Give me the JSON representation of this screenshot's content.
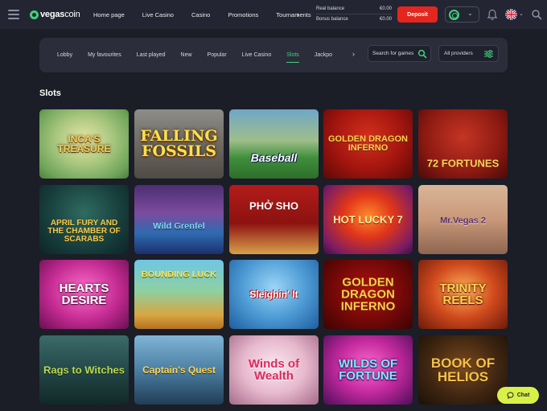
{
  "brand": {
    "name_bold": "vegas",
    "name_light": "coin"
  },
  "topnav": {
    "items": [
      "Home page",
      "Live Casino",
      "Casino",
      "Promotions",
      "Tournaments"
    ],
    "more_arrow": "›"
  },
  "balances": {
    "real_label": "Real balance",
    "real_value": "€0.00",
    "bonus_label": "Bonus balance",
    "bonus_value": "€0.00"
  },
  "header": {
    "deposit_label": "Deposit",
    "chevron": "⌄"
  },
  "categories": {
    "items": [
      "Lobby",
      "My favourites",
      "Last played",
      "New",
      "Popular",
      "Live Casino",
      "Slots",
      "Jackpo"
    ],
    "active": "Slots",
    "more_arrow": "›",
    "search_placeholder": "Search for games",
    "providers_label": "All providers"
  },
  "section_title": "Slots",
  "games": [
    {
      "title": "INCA'S TREASURE"
    },
    {
      "title": "FALLING FOSSILS"
    },
    {
      "title": "Baseball"
    },
    {
      "title": "Golden Dragon Inferno"
    },
    {
      "title": "72 FORTUNES"
    },
    {
      "title": "APRIL FURY AND THE CHAMBER OF SCARABS"
    },
    {
      "title": "Wild Grenfel"
    },
    {
      "title": "PHỞ SHO"
    },
    {
      "title": "HOT LUCKY 7"
    },
    {
      "title": "Mr.Vegas 2"
    },
    {
      "title": "HEARTS DESIRE"
    },
    {
      "title": "BOUNDING LUCK"
    },
    {
      "title": "Sleighin' It"
    },
    {
      "title": "GOLDEN DRAGON INFERNO"
    },
    {
      "title": "TRINITY REELS"
    },
    {
      "title": "Rags to Witches"
    },
    {
      "title": "Captain's Quest"
    },
    {
      "title": "Winds of Wealth"
    },
    {
      "title": "WILDS OF FORTUNE"
    },
    {
      "title": "BOOK OF HELIOS"
    }
  ],
  "chat": {
    "label": "Chat"
  },
  "colors": {
    "accent": "#3fd17c",
    "deposit": "#e4261e",
    "chat": "#d7f04a",
    "background": "#1b1d27"
  }
}
